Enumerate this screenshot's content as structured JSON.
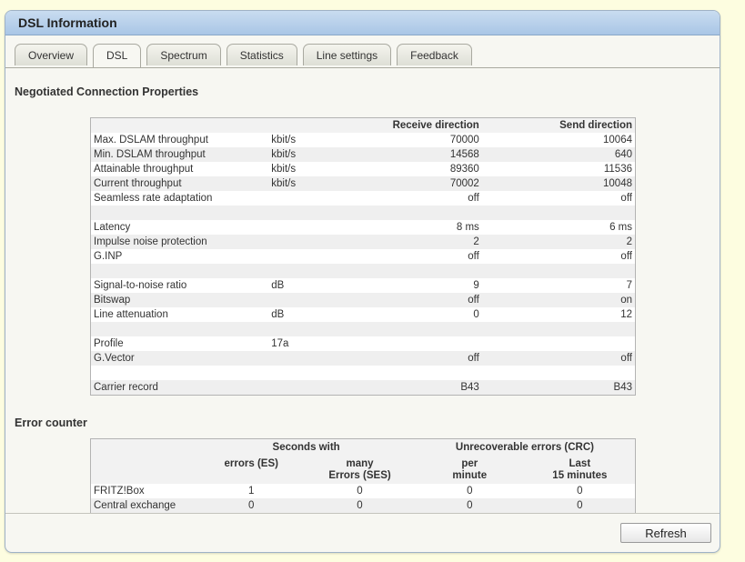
{
  "header": {
    "title": "DSL Information"
  },
  "tabs": [
    {
      "label": "Overview"
    },
    {
      "label": "DSL",
      "active": true
    },
    {
      "label": "Spectrum"
    },
    {
      "label": "Statistics"
    },
    {
      "label": "Line settings"
    },
    {
      "label": "Feedback"
    }
  ],
  "props": {
    "title": "Negotiated Connection Properties",
    "col_receive": "Receive direction",
    "col_send": "Send direction",
    "rows": [
      {
        "label": "Max. DSLAM throughput",
        "unit": "kbit/s",
        "rx": "70000",
        "tx": "10064"
      },
      {
        "label": "Min. DSLAM throughput",
        "unit": "kbit/s",
        "rx": "14568",
        "tx": "640"
      },
      {
        "label": "Attainable throughput",
        "unit": "kbit/s",
        "rx": "89360",
        "tx": "11536"
      },
      {
        "label": "Current throughput",
        "unit": "kbit/s",
        "rx": "70002",
        "tx": "10048"
      },
      {
        "label": "Seamless rate adaptation",
        "unit": "",
        "rx": "off",
        "tx": "off"
      },
      {
        "label": "",
        "unit": "",
        "rx": "",
        "tx": ""
      },
      {
        "label": "Latency",
        "unit": "",
        "rx": "8 ms",
        "tx": "6 ms"
      },
      {
        "label": "Impulse noise protection",
        "unit": "",
        "rx": "2",
        "tx": "2"
      },
      {
        "label": "G.INP",
        "unit": "",
        "rx": "off",
        "tx": "off"
      },
      {
        "label": "",
        "unit": "",
        "rx": "",
        "tx": ""
      },
      {
        "label": "Signal-to-noise ratio",
        "unit": "dB",
        "rx": "9",
        "tx": "7"
      },
      {
        "label": "Bitswap",
        "unit": "",
        "rx": "off",
        "tx": "on"
      },
      {
        "label": "Line attenuation",
        "unit": "dB",
        "rx": "0",
        "tx": "12"
      },
      {
        "label": "",
        "unit": "",
        "rx": "",
        "tx": ""
      },
      {
        "label": "Profile",
        "unit": "17a",
        "rx": "",
        "tx": ""
      },
      {
        "label": "G.Vector",
        "unit": "",
        "rx": "off",
        "tx": "off"
      },
      {
        "label": "",
        "unit": "",
        "rx": "",
        "tx": ""
      },
      {
        "label": "Carrier record",
        "unit": "",
        "rx": "B43",
        "tx": "B43"
      }
    ]
  },
  "errors": {
    "title": "Error counter",
    "group_seconds": "Seconds with",
    "group_crc": "Unrecoverable errors (CRC)",
    "col_es": "errors (ES)",
    "col_ses_1": "many",
    "col_ses_2": "Errors (SES)",
    "col_per_1": "per",
    "col_per_2": "minute",
    "col_last_1": "Last",
    "col_last_2": "15 minutes",
    "rows": [
      {
        "label": "FRITZ!Box",
        "es": "1",
        "ses": "0",
        "per": "0",
        "last": "0"
      },
      {
        "label": "Central exchange",
        "es": "0",
        "ses": "0",
        "per": "0",
        "last": "0"
      }
    ]
  },
  "footer": {
    "refresh_label": "Refresh"
  }
}
